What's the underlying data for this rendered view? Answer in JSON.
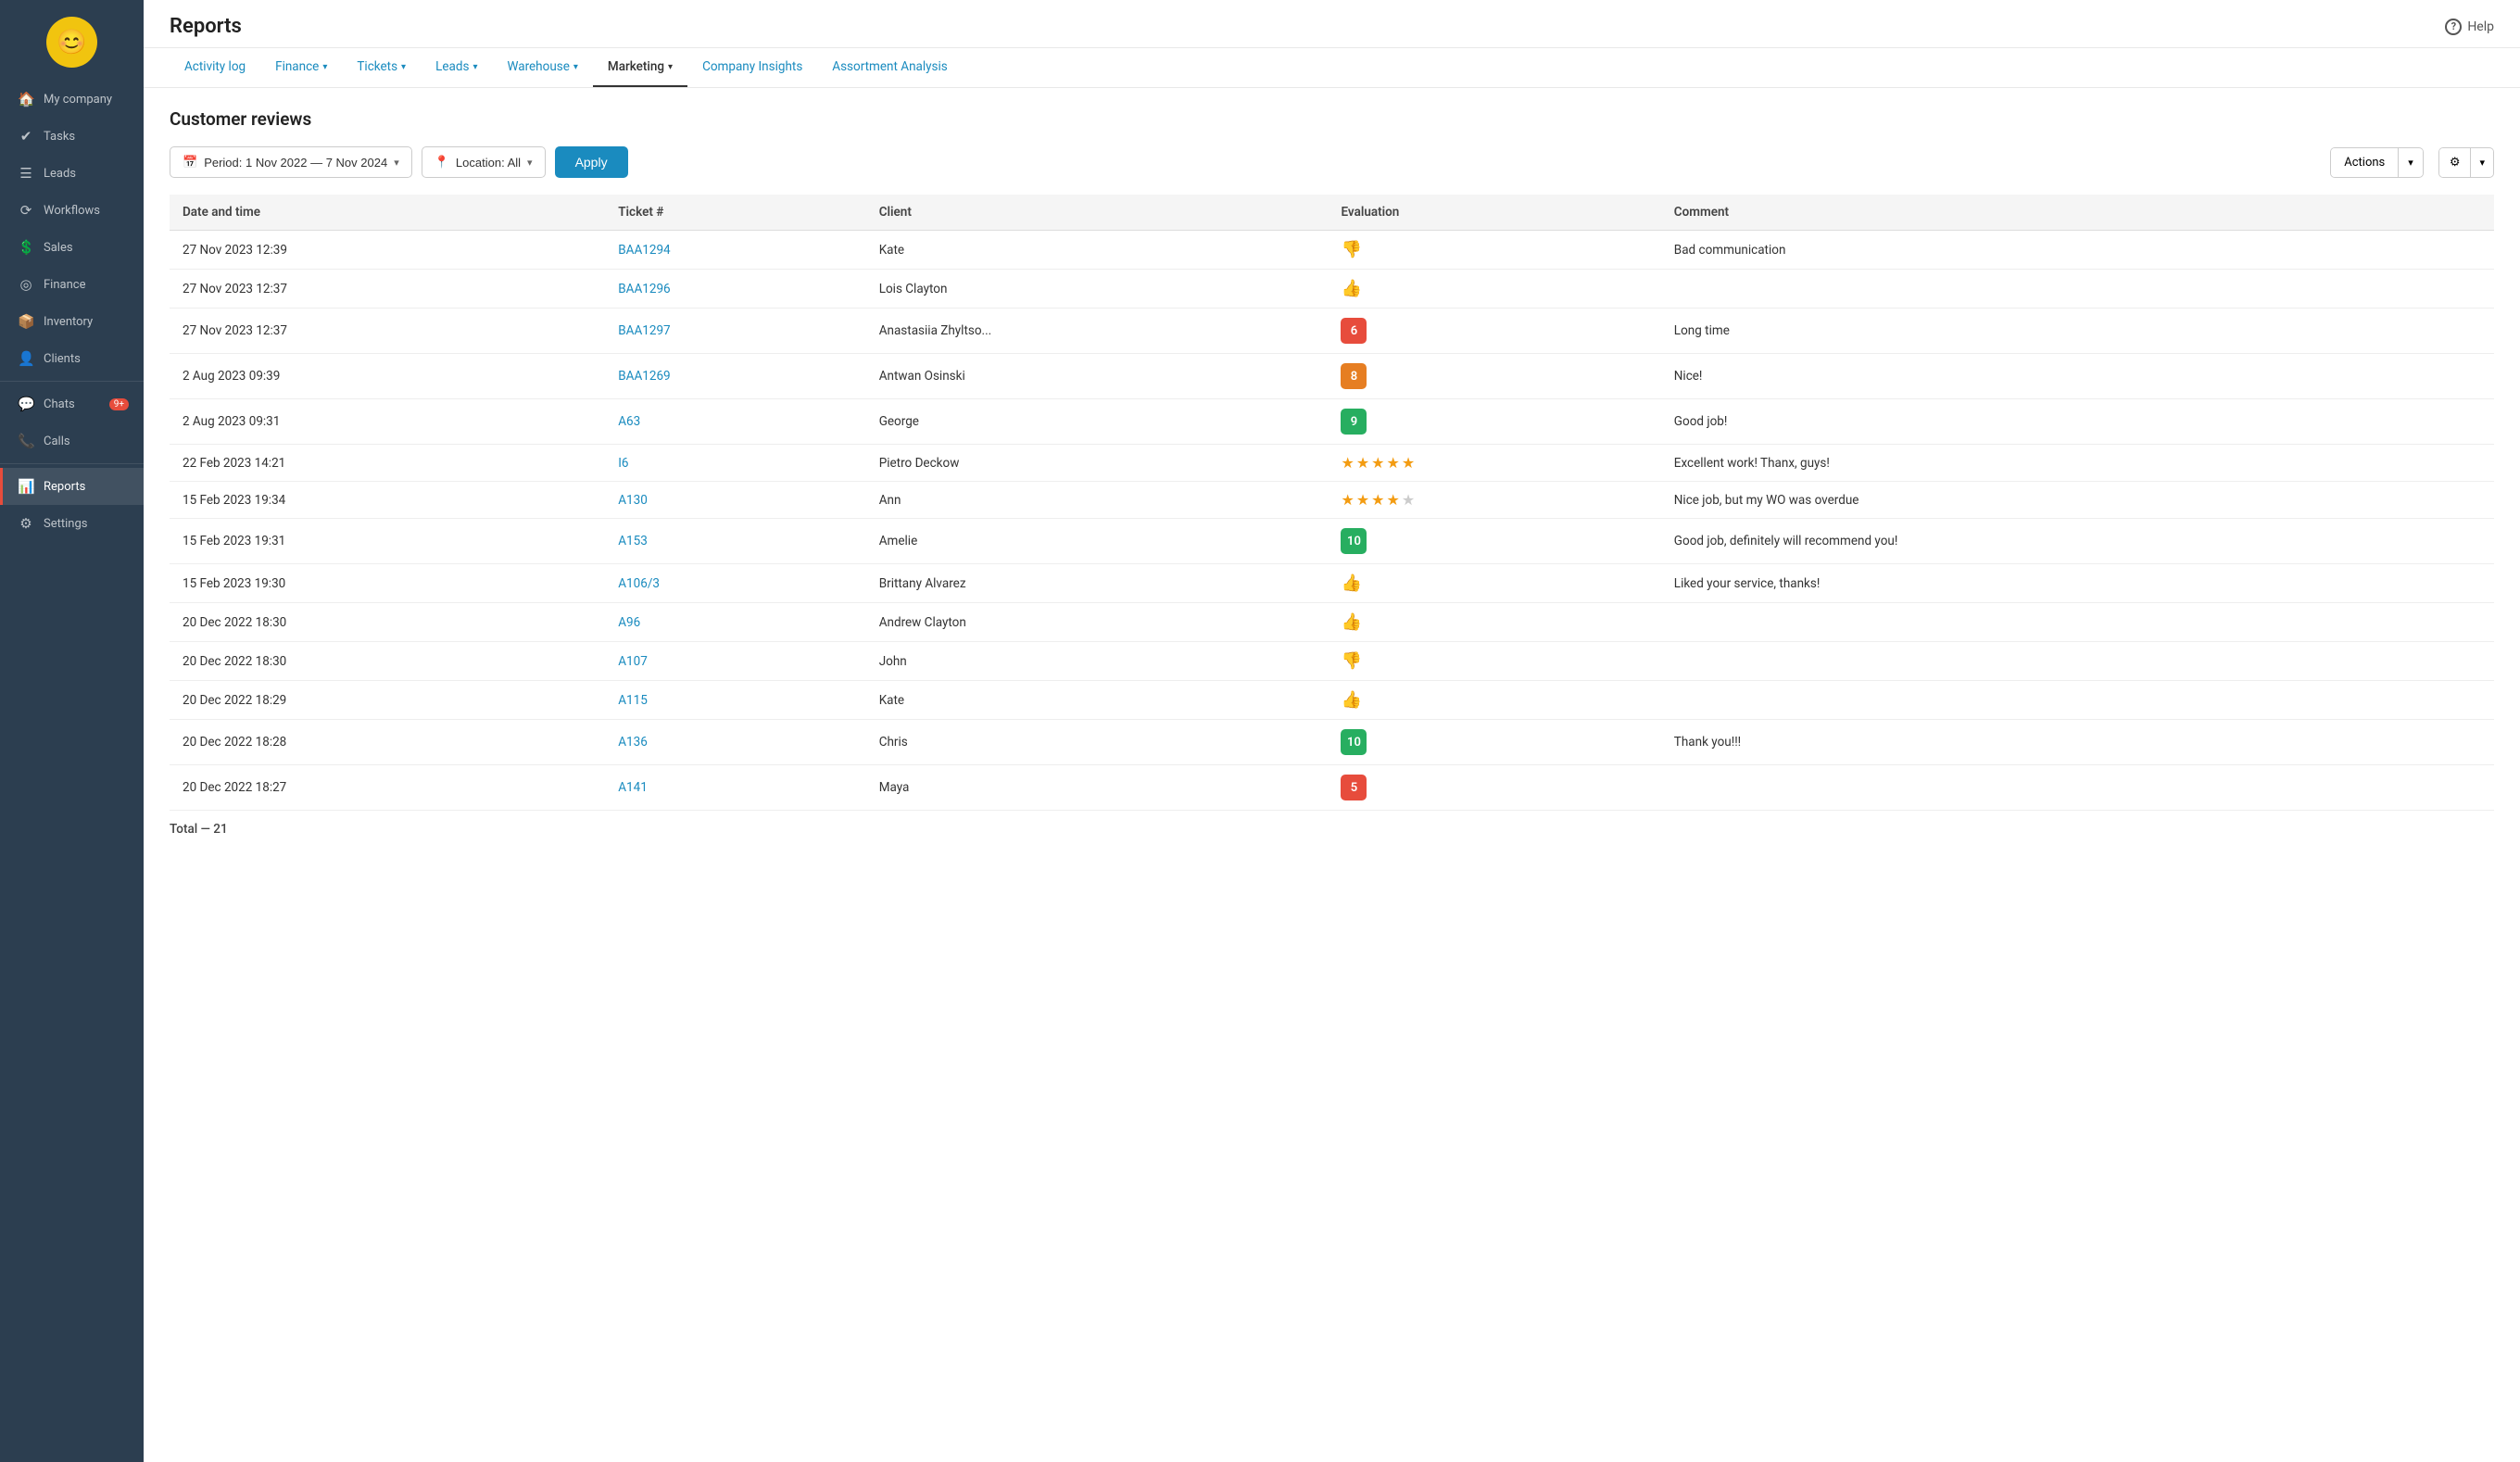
{
  "sidebar": {
    "avatar_emoji": "😊",
    "items": [
      {
        "id": "my-company",
        "label": "My company",
        "icon": "🏠",
        "active": false
      },
      {
        "id": "tasks",
        "label": "Tasks",
        "icon": "✔",
        "active": false
      },
      {
        "id": "leads",
        "label": "Leads",
        "icon": "☰",
        "active": false
      },
      {
        "id": "workflows",
        "label": "Workflows",
        "icon": "⟳",
        "active": false
      },
      {
        "id": "sales",
        "label": "Sales",
        "icon": "$",
        "active": false
      },
      {
        "id": "finance",
        "label": "Finance",
        "icon": "◎",
        "active": false
      },
      {
        "id": "inventory",
        "label": "Inventory",
        "icon": "📦",
        "active": false
      },
      {
        "id": "clients",
        "label": "Clients",
        "icon": "👤",
        "active": false
      },
      {
        "id": "chats",
        "label": "Chats",
        "icon": "💬",
        "active": false,
        "badge": "9+"
      },
      {
        "id": "calls",
        "label": "Calls",
        "icon": "📞",
        "active": false
      },
      {
        "id": "reports",
        "label": "Reports",
        "icon": "📊",
        "active": true
      },
      {
        "id": "settings",
        "label": "Settings",
        "icon": "⚙",
        "active": false
      }
    ]
  },
  "header": {
    "title": "Reports",
    "help_label": "Help"
  },
  "tabs": [
    {
      "id": "activity-log",
      "label": "Activity log",
      "has_chevron": false
    },
    {
      "id": "finance",
      "label": "Finance",
      "has_chevron": true
    },
    {
      "id": "tickets",
      "label": "Tickets",
      "has_chevron": true
    },
    {
      "id": "leads",
      "label": "Leads",
      "has_chevron": true
    },
    {
      "id": "warehouse",
      "label": "Warehouse",
      "has_chevron": true
    },
    {
      "id": "marketing",
      "label": "Marketing",
      "has_chevron": true,
      "active": true
    },
    {
      "id": "company-insights",
      "label": "Company Insights",
      "has_chevron": false
    },
    {
      "id": "assortment-analysis",
      "label": "Assortment Analysis",
      "has_chevron": false
    }
  ],
  "page": {
    "subtitle": "Customer reviews",
    "filter_period_label": "Period: 1 Nov 2022 — 7 Nov 2024",
    "filter_location_label": "Location: All",
    "apply_label": "Apply",
    "actions_label": "Actions"
  },
  "table": {
    "columns": [
      "Date and time",
      "Ticket #",
      "Client",
      "Evaluation",
      "Comment"
    ],
    "rows": [
      {
        "datetime": "27 Nov 2023 12:39",
        "ticket": "BAA1294",
        "client": "Kate",
        "eval_type": "thumb_down",
        "eval_value": "",
        "comment": "Bad communication"
      },
      {
        "datetime": "27 Nov 2023 12:37",
        "ticket": "BAA1296",
        "client": "Lois Clayton",
        "eval_type": "thumb_up",
        "eval_value": "",
        "comment": ""
      },
      {
        "datetime": "27 Nov 2023 12:37",
        "ticket": "BAA1297",
        "client": "Anastasiia Zhyltso...",
        "eval_type": "num",
        "eval_value": "6",
        "eval_color": "red",
        "comment": "Long time"
      },
      {
        "datetime": "2 Aug 2023 09:39",
        "ticket": "BAA1269",
        "client": "Antwan Osinski",
        "eval_type": "num",
        "eval_value": "8",
        "eval_color": "orange",
        "comment": "Nice!"
      },
      {
        "datetime": "2 Aug 2023 09:31",
        "ticket": "A63",
        "client": "George",
        "eval_type": "num",
        "eval_value": "9",
        "eval_color": "green",
        "comment": "Good job!"
      },
      {
        "datetime": "22 Feb 2023 14:21",
        "ticket": "I6",
        "client": "Pietro Deckow",
        "eval_type": "stars",
        "eval_value": "5",
        "comment": "Excellent work! Thanx, guys!"
      },
      {
        "datetime": "15 Feb 2023 19:34",
        "ticket": "A130",
        "client": "Ann",
        "eval_type": "stars",
        "eval_value": "4",
        "comment": "Nice job, but my WO was overdue"
      },
      {
        "datetime": "15 Feb 2023 19:31",
        "ticket": "A153",
        "client": "Amelie",
        "eval_type": "num",
        "eval_value": "10",
        "eval_color": "green",
        "comment": "Good job, definitely will recommend you!"
      },
      {
        "datetime": "15 Feb 2023 19:30",
        "ticket": "A106/3",
        "client": "Brittany Alvarez",
        "eval_type": "thumb_up",
        "eval_value": "",
        "comment": "Liked your service, thanks!"
      },
      {
        "datetime": "20 Dec 2022 18:30",
        "ticket": "A96",
        "client": "Andrew Clayton",
        "eval_type": "thumb_up",
        "eval_value": "",
        "comment": ""
      },
      {
        "datetime": "20 Dec 2022 18:30",
        "ticket": "A107",
        "client": "John",
        "eval_type": "thumb_down",
        "eval_value": "",
        "comment": ""
      },
      {
        "datetime": "20 Dec 2022 18:29",
        "ticket": "A115",
        "client": "Kate",
        "eval_type": "thumb_up",
        "eval_value": "",
        "comment": ""
      },
      {
        "datetime": "20 Dec 2022 18:28",
        "ticket": "A136",
        "client": "Chris",
        "eval_type": "num",
        "eval_value": "10",
        "eval_color": "green",
        "comment": "Thank you!!!"
      },
      {
        "datetime": "20 Dec 2022 18:27",
        "ticket": "A141",
        "client": "Maya",
        "eval_type": "num",
        "eval_value": "5",
        "eval_color": "red",
        "comment": ""
      }
    ],
    "total_label": "Total — 21"
  }
}
